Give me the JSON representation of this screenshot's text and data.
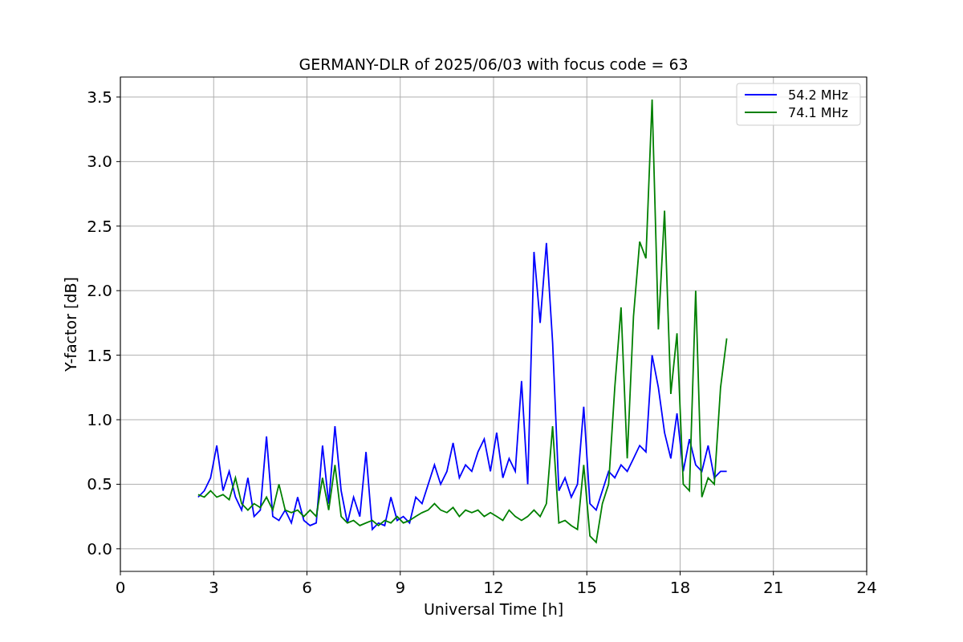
{
  "chart_data": {
    "type": "line",
    "title": "GERMANY-DLR of 2025/06/03 with focus code = 63",
    "xlabel": "Universal Time [h]",
    "ylabel": "Y-factor [dB]",
    "x": [
      2.5,
      2.7,
      2.9,
      3.1,
      3.3,
      3.5,
      3.7,
      3.9,
      4.1,
      4.3,
      4.5,
      4.7,
      4.9,
      5.1,
      5.3,
      5.5,
      5.7,
      5.9,
      6.1,
      6.3,
      6.5,
      6.7,
      6.9,
      7.1,
      7.3,
      7.5,
      7.7,
      7.9,
      8.1,
      8.3,
      8.5,
      8.7,
      8.9,
      9.1,
      9.3,
      9.5,
      9.7,
      9.9,
      10.1,
      10.3,
      10.5,
      10.7,
      10.9,
      11.1,
      11.3,
      11.5,
      11.7,
      11.9,
      12.1,
      12.3,
      12.5,
      12.7,
      12.9,
      13.1,
      13.3,
      13.5,
      13.7,
      13.9,
      14.1,
      14.3,
      14.5,
      14.7,
      14.9,
      15.1,
      15.3,
      15.5,
      15.7,
      15.9,
      16.1,
      16.3,
      16.5,
      16.7,
      16.9,
      17.1,
      17.3,
      17.5,
      17.7,
      17.9,
      18.1,
      18.3,
      18.5,
      18.7,
      18.9,
      19.1,
      19.3,
      19.5
    ],
    "series": [
      {
        "name": "54.2 MHz",
        "color": "#0000ff",
        "values": [
          0.4,
          0.45,
          0.55,
          0.8,
          0.45,
          0.6,
          0.4,
          0.3,
          0.55,
          0.25,
          0.3,
          0.87,
          0.25,
          0.22,
          0.3,
          0.2,
          0.4,
          0.22,
          0.18,
          0.2,
          0.8,
          0.35,
          0.95,
          0.45,
          0.2,
          0.4,
          0.25,
          0.75,
          0.15,
          0.2,
          0.18,
          0.4,
          0.22,
          0.25,
          0.2,
          0.4,
          0.35,
          0.5,
          0.65,
          0.5,
          0.6,
          0.82,
          0.55,
          0.65,
          0.6,
          0.75,
          0.85,
          0.6,
          0.9,
          0.55,
          0.7,
          0.6,
          1.3,
          0.5,
          2.3,
          1.75,
          2.37,
          1.6,
          0.45,
          0.55,
          0.4,
          0.5,
          1.1,
          0.35,
          0.3,
          0.45,
          0.6,
          0.55,
          0.65,
          0.6,
          0.7,
          0.8,
          0.75,
          1.5,
          1.25,
          0.9,
          0.7,
          1.05,
          0.6,
          0.85,
          0.65,
          0.6,
          0.8,
          0.55,
          0.6,
          0.6
        ]
      },
      {
        "name": "74.1 MHz",
        "color": "#008000",
        "values": [
          0.42,
          0.4,
          0.45,
          0.4,
          0.42,
          0.38,
          0.55,
          0.35,
          0.3,
          0.35,
          0.32,
          0.4,
          0.3,
          0.5,
          0.3,
          0.28,
          0.3,
          0.25,
          0.3,
          0.25,
          0.55,
          0.3,
          0.65,
          0.25,
          0.2,
          0.22,
          0.18,
          0.2,
          0.22,
          0.18,
          0.22,
          0.2,
          0.25,
          0.2,
          0.22,
          0.25,
          0.28,
          0.3,
          0.35,
          0.3,
          0.28,
          0.32,
          0.25,
          0.3,
          0.28,
          0.3,
          0.25,
          0.28,
          0.25,
          0.22,
          0.3,
          0.25,
          0.22,
          0.25,
          0.3,
          0.25,
          0.35,
          0.95,
          0.2,
          0.22,
          0.18,
          0.15,
          0.65,
          0.1,
          0.05,
          0.35,
          0.5,
          1.25,
          1.87,
          0.7,
          1.8,
          2.38,
          2.25,
          3.48,
          1.7,
          2.62,
          1.2,
          1.67,
          0.5,
          0.45,
          2.0,
          0.4,
          0.55,
          0.5,
          1.25,
          1.63
        ]
      }
    ],
    "grid": true,
    "legend": true,
    "xlim": [
      0,
      24
    ],
    "ylim": [
      -0.175,
      3.655
    ],
    "xticks": [
      0,
      3,
      6,
      9,
      12,
      15,
      18,
      21,
      24
    ],
    "yticks": [
      {
        "value": 0,
        "label": "0.0"
      },
      {
        "value": 0.5,
        "label": "0.5"
      },
      {
        "value": 1,
        "label": "1.0"
      },
      {
        "value": 1.5,
        "label": "1.5"
      },
      {
        "value": 2,
        "label": "2.0"
      },
      {
        "value": 2.5,
        "label": "2.5"
      },
      {
        "value": 3,
        "label": "3.0"
      },
      {
        "value": 3.5,
        "label": "3.5"
      }
    ]
  }
}
